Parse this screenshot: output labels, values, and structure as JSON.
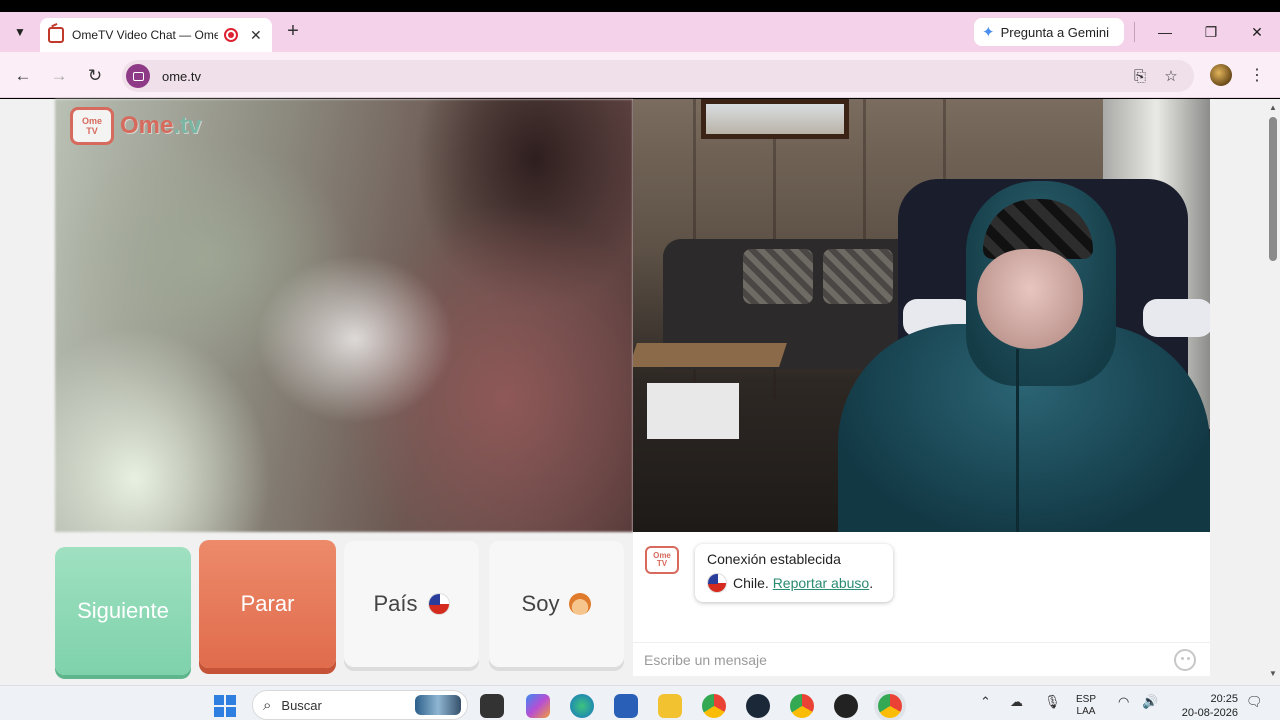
{
  "browser": {
    "tab": {
      "title": "OmeTV Video Chat — Ome"
    },
    "gemini_label": "Pregunta a Gemini",
    "url": "ome.tv"
  },
  "site": {
    "logo": {
      "tv_top": "Ome",
      "tv_bottom": "TV",
      "word_a": "Ome",
      "word_b": ".tv"
    }
  },
  "controls": {
    "next_label": "Siguiente",
    "stop_label": "Parar",
    "country_label": "País",
    "gender_label": "Soy"
  },
  "chat": {
    "logo_top": "Ome",
    "logo_bottom": "TV",
    "status": "Conexión establecida",
    "country": "Chile.",
    "report_link": "Reportar abuso",
    "report_suffix": ".",
    "input_placeholder": "Escribe un mensaje"
  },
  "taskbar": {
    "search_label": "Buscar",
    "language_top": "ESP",
    "language_bottom": "LAA",
    "time": "20:25",
    "date": "20-08-2026"
  },
  "colors": {
    "brand_red": "#d66a5d",
    "next_green": "#8ed8b6",
    "stop_red": "#e57a5a",
    "tab_strip": "#f4d3ea"
  },
  "icons": [
    "dropdown-icon",
    "favicon",
    "record-icon",
    "close-icon",
    "plus-icon",
    "gemini-icon",
    "minimize-icon",
    "restore-icon",
    "window-close-icon",
    "back-icon",
    "forward-icon",
    "reload-icon",
    "install-icon",
    "star-icon",
    "menu-icon",
    "flag-chile-icon",
    "boy-emoji-icon",
    "emoji-icon"
  ]
}
